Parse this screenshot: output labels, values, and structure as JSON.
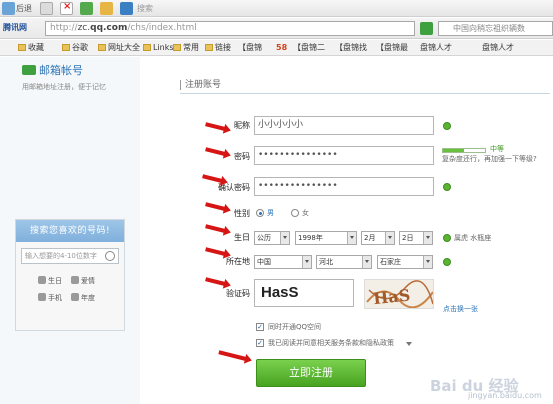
{
  "browser": {
    "back_label": "后退",
    "history_label": "搜索",
    "url_host": "zc.",
    "url_bold": "qq.com",
    "url_path": "/chs/index.html",
    "search_placeholder": "中国向稍忘祖织辆数",
    "go_label": "→",
    "bookmarks": [
      "腾讯网",
      "收藏",
      "谷歌",
      "网址大全",
      "Links",
      "常用",
      "链接",
      "【盘锦",
      "58",
      "【盘锦二",
      "【盘锦找",
      "【盘锦最",
      "盘锦人才",
      "盘锦人才"
    ]
  },
  "left": {
    "mail_title": "邮箱帐号",
    "mail_sub": "用邮箱地址注册，便于记忆",
    "num_title": "搜索您喜欢的号码!",
    "num_placeholder": "输入想要的4-10位数字",
    "options": [
      "生日",
      "爱情",
      "手机",
      "年度"
    ]
  },
  "form": {
    "section_title": "注册账号",
    "nickname_label": "昵称",
    "nickname_value": "小小小小小",
    "password_label": "密码",
    "password_value": "•••••••••••••••",
    "strength_label": "中等",
    "strength_level": 0.5,
    "strength_hint": "复杂度还行，再加强一下等级?",
    "confirm_label": "确认密码",
    "confirm_value": "•••••••••••••••",
    "gender_label": "性别",
    "gender_male": "男",
    "gender_female": "女",
    "birthday_label": "生日",
    "calendar": "公历",
    "year": "1998年",
    "month": "2月",
    "day": "2日",
    "zodiac": "属虎  水瓶座",
    "location_label": "所在地",
    "country": "中国",
    "province": "河北",
    "city": "石家庄",
    "captcha_label": "验证码",
    "captcha_value": "HasS",
    "captcha_img_text": "HaS",
    "captcha_refresh": "点击换一张",
    "agree_qzone": "同时开通QQ空间",
    "agree_terms": "我已阅读并同意相关服务条款和隐私政策",
    "submit_label": "立即注册"
  },
  "watermark": {
    "brand": "Bai du 经验",
    "site": "jingyan.baidu.com"
  },
  "colors": {
    "accent": "#2d74b5",
    "ok_green": "#5cb432",
    "submit_green": "#47a320",
    "arrow_red": "#d61515"
  }
}
